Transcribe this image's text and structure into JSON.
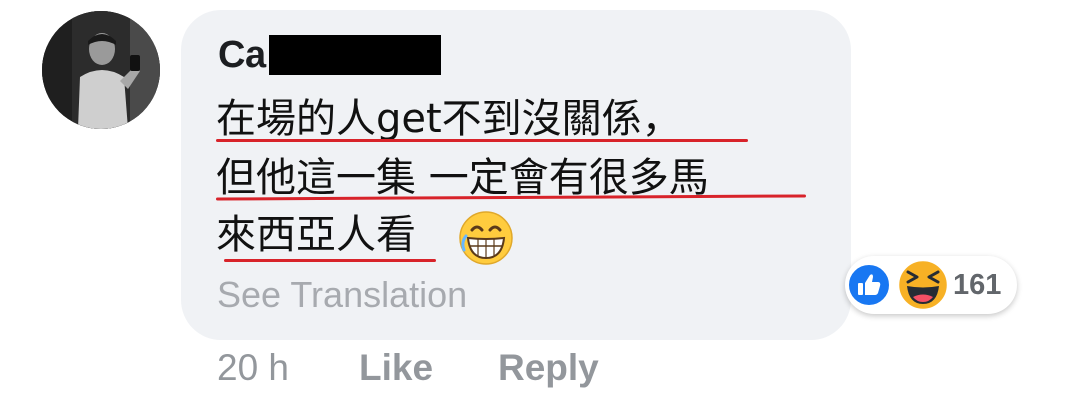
{
  "comment": {
    "author_visible": "Ca",
    "lines": [
      "在場的人get不到沒關係，",
      "但他這一集 一定會有很多馬",
      "來西亞人看"
    ],
    "emoji": "grinning-sweat-emoji",
    "see_translation": "See Translation"
  },
  "reactions": {
    "icons": [
      "like-icon",
      "haha-icon"
    ],
    "count": "161"
  },
  "actions": {
    "timestamp": "20 h",
    "like_label": "Like",
    "reply_label": "Reply"
  },
  "colors": {
    "bubble": "#f0f2f5",
    "underline": "#d8232a",
    "like_blue": "#1877f2",
    "haha_yellow": "#f7b125",
    "meta_text": "#93979c"
  }
}
